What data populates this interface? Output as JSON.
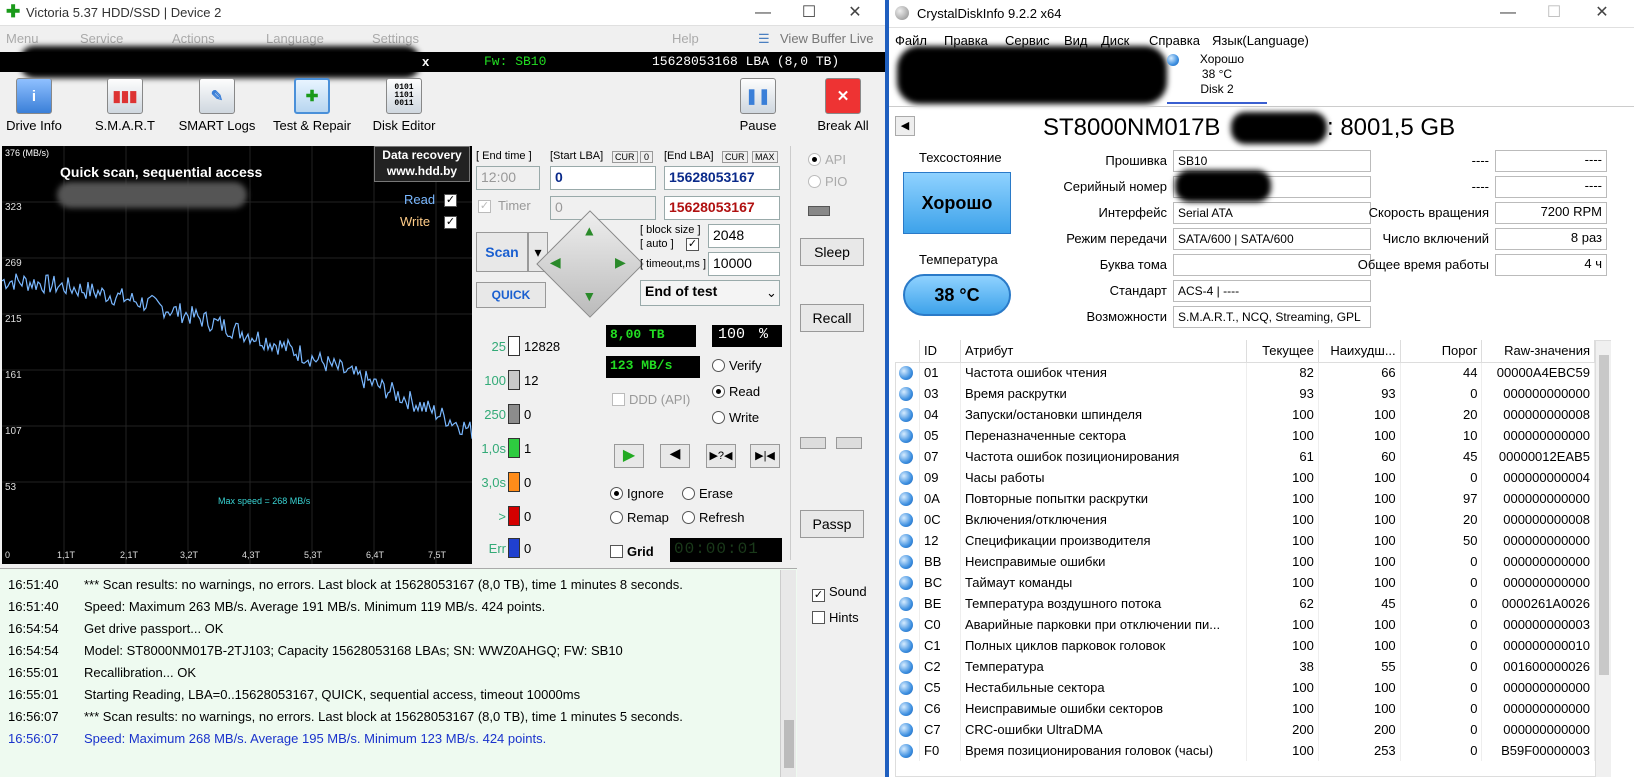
{
  "victoria": {
    "title": "Victoria 5.37 HDD/SSD | Device 2",
    "menu": [
      "Menu",
      "Service",
      "Actions",
      "Language",
      "Settings",
      "Help"
    ],
    "view_buffer_live": "View Buffer Live",
    "status_bar": {
      "fw": "Fw: SB10",
      "lba": "15628053168 LBA (8,0 TB)",
      "x": "x"
    },
    "toolbar": [
      "Drive Info",
      "S.M.A.R.T",
      "SMART Logs",
      "Test & Repair",
      "Disk Editor"
    ],
    "pause_label": "Pause",
    "break_all_label": "Break All",
    "graph": {
      "y_ticks": [
        "376 (MB/s)",
        "323",
        "269",
        "215",
        "161",
        "107",
        "53",
        "0"
      ],
      "x_ticks": [
        "0",
        "1,1T",
        "2,1T",
        "3,2T",
        "4,3T",
        "5,3T",
        "6,4T",
        "7,5T"
      ],
      "title": "Quick scan, sequential access",
      "watermark": "Data recovery\nwww.hdd.by",
      "read_label": "Read",
      "write_label": "Write",
      "max_speed": "Max speed = 268 MB/s",
      "read_color": "#7ab8ff",
      "write_color": "#ffcc88"
    },
    "controls": {
      "end_time_label": "[ End time ]",
      "end_time_value": "12:00",
      "timer_label": "Timer",
      "timer_value": "0",
      "start_lba_label": "[Start LBA]",
      "start_lba_value": "0",
      "end_lba_label": "[End LBA]",
      "end_lba_value": "15628053167",
      "end_lba_value2": "15628053167",
      "cur": "CUR",
      "cur_zero": "0",
      "max": "MAX",
      "scan_label": "Scan",
      "quick_label": "QUICK",
      "block_size_label": "[ block size ]",
      "auto_label": "[ auto ]",
      "block_size_value": "2048",
      "timeout_label": "[ timeout,ms ]",
      "timeout_value": "10000",
      "end_of_test": "End of test",
      "api": "API",
      "pio": "PIO",
      "sleep": "Sleep",
      "recall": "Recall",
      "passp": "Passp"
    },
    "legend": [
      {
        "cap": "25",
        "count": "12828",
        "color": "#ffffff"
      },
      {
        "cap": "100",
        "count": "12",
        "color": "#c8c8c8"
      },
      {
        "cap": "250",
        "count": "0",
        "color": "#8c8c8c"
      },
      {
        "cap": "1,0s",
        "count": "1",
        "color": "#2ecc40"
      },
      {
        "cap": "3,0s",
        "count": "0",
        "color": "#ff8c1a"
      },
      {
        "cap": ">",
        "count": "0",
        "color": "#d40000"
      },
      {
        "cap": "Err",
        "count": "0",
        "color": "#2040d0"
      }
    ],
    "stats": {
      "size": "8,00 TB",
      "percent": "100",
      "percent_sign": "%",
      "speed": "123 MB/s",
      "verify": "Verify",
      "read": "Read",
      "write": "Write",
      "ddd": "DDD (API)",
      "ignore": "Ignore",
      "erase": "Erase",
      "remap": "Remap",
      "refresh": "Refresh",
      "grid": "Grid",
      "clock": "00:00:01"
    },
    "side": {
      "sound": "Sound",
      "hints": "Hints"
    },
    "log": [
      {
        "time": "16:51:40",
        "text": "*** Scan results: no warnings, no errors. Last block at 15628053167 (8,0 TB), time 1 minutes 8 seconds.",
        "color": "#000000"
      },
      {
        "time": "16:51:40",
        "text": "Speed: Maximum 263 MB/s. Average 191 MB/s. Minimum 119 MB/s. 424 points.",
        "color": "#000000"
      },
      {
        "time": "16:54:54",
        "text": "Get drive passport... OK",
        "color": "#000000"
      },
      {
        "time": "16:54:54",
        "text": "Model: ST8000NM017B-2TJ103; Capacity 15628053168 LBAs; SN: WWZ0AHGQ; FW: SB10",
        "color": "#000000"
      },
      {
        "time": "16:55:01",
        "text": "Recallibration... OK",
        "color": "#000000"
      },
      {
        "time": "16:55:01",
        "text": "Starting Reading, LBA=0..15628053167, QUICK, sequential access, timeout 10000ms",
        "color": "#000000"
      },
      {
        "time": "16:56:07",
        "text": "*** Scan results: no warnings, no errors. Last block at 15628053167 (8,0 TB), time 1 minutes 5 seconds.",
        "color": "#000000"
      },
      {
        "time": "16:56:07",
        "text": "Speed: Maximum 268 MB/s. Average 195 MB/s. Minimum 123 MB/s. 424 points.",
        "color": "#1a33cc"
      }
    ]
  },
  "crystal": {
    "title": "CrystalDiskInfo 9.2.2 x64",
    "menu": [
      "Файл",
      "Правка",
      "Сервис",
      "Вид",
      "Диск",
      "Справка",
      "Язык(Language)"
    ],
    "disk_tab": {
      "status": "Хорошо",
      "temp": "38 °C",
      "name": "Disk 2"
    },
    "model": "ST8000NM017B",
    "capacity": ": 8001,5 GB",
    "health_label": "Техсостояние",
    "health_value": "Хорошо",
    "temp_label": "Температура",
    "temp_value": "38 °C",
    "info": [
      {
        "label": "Прошивка",
        "value": "SB10"
      },
      {
        "label": "Серийный номер",
        "value": ""
      },
      {
        "label": "Интерфейс",
        "value": "Serial ATA"
      },
      {
        "label": "Режим передачи",
        "value": "SATA/600 | SATA/600"
      },
      {
        "label": "Буква тома",
        "value": ""
      },
      {
        "label": "Стандарт",
        "value": "ACS-4 | ----"
      },
      {
        "label": "Возможности",
        "value": "S.M.A.R.T., NCQ, Streaming, GPL"
      }
    ],
    "right_info": [
      {
        "label": "----",
        "value": "----"
      },
      {
        "label": "----",
        "value": "----"
      },
      {
        "label": "Скорость вращения",
        "value": "7200 RPM"
      },
      {
        "label": "Число включений",
        "value": "8 раз"
      },
      {
        "label": "Общее время работы",
        "value": "4 ч"
      }
    ],
    "columns": [
      "ID",
      "Атрибут",
      "Текущее",
      "Наихудш...",
      "Порог",
      "Raw-значения"
    ],
    "rows": [
      [
        "01",
        "Частота ошибок чтения",
        "82",
        "66",
        "44",
        "00000A4EBC59"
      ],
      [
        "03",
        "Время раскрутки",
        "93",
        "93",
        "0",
        "000000000000"
      ],
      [
        "04",
        "Запуски/остановки шпинделя",
        "100",
        "100",
        "20",
        "000000000008"
      ],
      [
        "05",
        "Переназначенные сектора",
        "100",
        "100",
        "10",
        "000000000000"
      ],
      [
        "07",
        "Частота ошибок позиционирования",
        "61",
        "60",
        "45",
        "00000012EAB5"
      ],
      [
        "09",
        "Часы работы",
        "100",
        "100",
        "0",
        "000000000004"
      ],
      [
        "0A",
        "Повторные попытки раскрутки",
        "100",
        "100",
        "97",
        "000000000000"
      ],
      [
        "0C",
        "Включения/отключения",
        "100",
        "100",
        "20",
        "000000000008"
      ],
      [
        "12",
        "Спецификации производителя",
        "100",
        "100",
        "50",
        "000000000000"
      ],
      [
        "BB",
        "Неисправимые ошибки",
        "100",
        "100",
        "0",
        "000000000000"
      ],
      [
        "BC",
        "Таймаут команды",
        "100",
        "100",
        "0",
        "000000000000"
      ],
      [
        "BE",
        "Температура воздушного потока",
        "62",
        "45",
        "0",
        "0000261A0026"
      ],
      [
        "C0",
        "Аварийные парковки при отключении пи...",
        "100",
        "100",
        "0",
        "000000000003"
      ],
      [
        "C1",
        "Полных циклов парковок головок",
        "100",
        "100",
        "0",
        "000000000010"
      ],
      [
        "C2",
        "Температура",
        "38",
        "55",
        "0",
        "001600000026"
      ],
      [
        "C5",
        "Нестабильные сектора",
        "100",
        "100",
        "0",
        "000000000000"
      ],
      [
        "C6",
        "Неисправимые ошибки секторов",
        "100",
        "100",
        "0",
        "000000000000"
      ],
      [
        "C7",
        "CRC-ошибки UltraDMA",
        "200",
        "200",
        "0",
        "000000000000"
      ],
      [
        "F0",
        "Время позиционирования головок (часы)",
        "100",
        "253",
        "0",
        "B59F00000003"
      ]
    ]
  }
}
